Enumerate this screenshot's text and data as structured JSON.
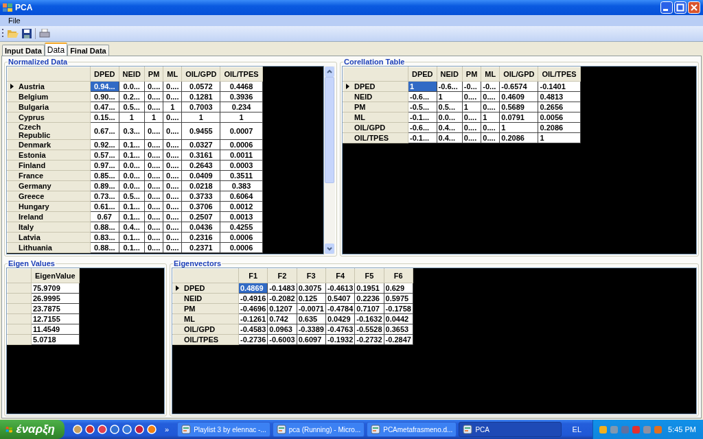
{
  "window": {
    "title": "PCA"
  },
  "menu": [
    "File"
  ],
  "tabs": [
    {
      "label": "Input Data",
      "selected": false
    },
    {
      "label": "Data",
      "selected": true
    },
    {
      "label": "Final Data",
      "selected": false
    }
  ],
  "normalized_data": {
    "title": "Normalized Data",
    "columns": [
      "DPED",
      "NEID",
      "PM",
      "ML",
      "OIL/GPD",
      "OIL/TPES"
    ],
    "rows": [
      {
        "header": "Austria",
        "selected": true,
        "cells": [
          "0.94...",
          "0.0...",
          "0....",
          "0....",
          "0.0572",
          "0.4468"
        ]
      },
      {
        "header": "Belgium",
        "selected": false,
        "cells": [
          "0.90...",
          "0.2...",
          "0....",
          "0....",
          "0.1281",
          "0.3936"
        ]
      },
      {
        "header": "Bulgaria",
        "selected": false,
        "cells": [
          "0.47...",
          "0.5...",
          "0....",
          "1",
          "0.7003",
          "0.234"
        ]
      },
      {
        "header": "Cyprus",
        "selected": false,
        "cells": [
          "0.15...",
          "1",
          "1",
          "0....",
          "1",
          "1"
        ]
      },
      {
        "header": "Czech Republic",
        "selected": false,
        "cells": [
          "0.67...",
          "0.3...",
          "0....",
          "0....",
          "0.9455",
          "0.0007"
        ]
      },
      {
        "header": "Denmark",
        "selected": false,
        "cells": [
          "0.92...",
          "0.1...",
          "0....",
          "0....",
          "0.0327",
          "0.0006"
        ]
      },
      {
        "header": "Estonia",
        "selected": false,
        "cells": [
          "0.57...",
          "0.1...",
          "0....",
          "0....",
          "0.3161",
          "0.0011"
        ]
      },
      {
        "header": "Finland",
        "selected": false,
        "cells": [
          "0.97...",
          "0.0...",
          "0....",
          "0....",
          "0.2643",
          "0.0003"
        ]
      },
      {
        "header": "France",
        "selected": false,
        "cells": [
          "0.85...",
          "0.0...",
          "0....",
          "0....",
          "0.0409",
          "0.3511"
        ]
      },
      {
        "header": "Germany",
        "selected": false,
        "cells": [
          "0.89...",
          "0.0...",
          "0....",
          "0....",
          "0.0218",
          "0.383"
        ]
      },
      {
        "header": "Greece",
        "selected": false,
        "cells": [
          "0.73...",
          "0.5...",
          "0....",
          "0....",
          "0.3733",
          "0.6064"
        ]
      },
      {
        "header": "Hungary",
        "selected": false,
        "cells": [
          "0.61...",
          "0.1...",
          "0....",
          "0....",
          "0.3706",
          "0.0012"
        ]
      },
      {
        "header": "Ireland",
        "selected": false,
        "cells": [
          "0.67",
          "0.1...",
          "0....",
          "0....",
          "0.2507",
          "0.0013"
        ]
      },
      {
        "header": "Italy",
        "selected": false,
        "cells": [
          "0.88...",
          "0.4...",
          "0....",
          "0....",
          "0.0436",
          "0.4255"
        ]
      },
      {
        "header": "Latvia",
        "selected": false,
        "cells": [
          "0.83...",
          "0.1...",
          "0....",
          "0....",
          "0.2316",
          "0.0006"
        ]
      },
      {
        "header": "Lithuania",
        "selected": false,
        "cells": [
          "0.88...",
          "0.1...",
          "0....",
          "0....",
          "0.2371",
          "0.0006"
        ]
      }
    ]
  },
  "correlation_table": {
    "title": "Corellation Table",
    "columns": [
      "DPED",
      "NEID",
      "PM",
      "ML",
      "OIL/GPD",
      "OIL/TPES"
    ],
    "rows": [
      {
        "header": "DPED",
        "selected": true,
        "cells": [
          "1",
          "-0.6...",
          "-0...",
          "-0...",
          "-0.6574",
          "-0.1401"
        ]
      },
      {
        "header": "NEID",
        "selected": false,
        "cells": [
          "-0.6...",
          "1",
          "0....",
          "0....",
          "0.4609",
          "0.4813"
        ]
      },
      {
        "header": "PM",
        "selected": false,
        "cells": [
          "-0.5...",
          "0.5...",
          "1",
          "0....",
          "0.5689",
          "0.2656"
        ]
      },
      {
        "header": "ML",
        "selected": false,
        "cells": [
          "-0.1...",
          "0.0...",
          "0....",
          "1",
          "0.0791",
          "0.0056"
        ]
      },
      {
        "header": "OIL/GPD",
        "selected": false,
        "cells": [
          "-0.6...",
          "0.4...",
          "0....",
          "0....",
          "1",
          "0.2086"
        ]
      },
      {
        "header": "OIL/TPES",
        "selected": false,
        "cells": [
          "-0.1...",
          "0.4...",
          "0....",
          "0....",
          "0.2086",
          "1"
        ]
      }
    ]
  },
  "eigen_values": {
    "title": "Eigen Values",
    "columns": [
      "EigenValue"
    ],
    "rows": [
      {
        "selected": false,
        "cells": [
          "75.9709"
        ]
      },
      {
        "selected": false,
        "cells": [
          "26.9995"
        ]
      },
      {
        "selected": false,
        "cells": [
          "23.7875"
        ]
      },
      {
        "selected": false,
        "cells": [
          "12.7155"
        ]
      },
      {
        "selected": false,
        "cells": [
          "11.4549"
        ]
      },
      {
        "selected": false,
        "cells": [
          "5.0718"
        ]
      }
    ]
  },
  "eigenvectors": {
    "title": "Eigenvectors",
    "columns": [
      "F1",
      "F2",
      "F3",
      "F4",
      "F5",
      "F6"
    ],
    "rows": [
      {
        "header": "DPED",
        "selected": true,
        "cells": [
          "0.4869",
          "-0.1483",
          "0.3075",
          "-0.4613",
          "0.1951",
          "0.629"
        ]
      },
      {
        "header": "NEID",
        "selected": false,
        "cells": [
          "-0.4916",
          "-0.2082",
          "0.125",
          "0.5407",
          "0.2236",
          "0.5975"
        ]
      },
      {
        "header": "PM",
        "selected": false,
        "cells": [
          "-0.4696",
          "0.1207",
          "-0.0071",
          "-0.4784",
          "0.7107",
          "-0.1758"
        ]
      },
      {
        "header": "ML",
        "selected": false,
        "cells": [
          "-0.1261",
          "0.742",
          "0.635",
          "0.0429",
          "-0.1632",
          "0.0442"
        ]
      },
      {
        "header": "OIL/GPD",
        "selected": false,
        "cells": [
          "-0.4583",
          "0.0963",
          "-0.3389",
          "-0.4763",
          "-0.5528",
          "0.3653"
        ]
      },
      {
        "header": "OIL/TPES",
        "selected": false,
        "cells": [
          "-0.2736",
          "-0.6003",
          "0.6097",
          "-0.1932",
          "-0.2732",
          "-0.2847"
        ]
      }
    ]
  },
  "taskbar": {
    "start": "έναρξη",
    "chevron": "»",
    "tasks": [
      {
        "label": "Playlist 3 by elennac -...",
        "selected": false
      },
      {
        "label": "pca (Running) - Micro...",
        "selected": false
      },
      {
        "label": "PCAmetafrasmeno.d...",
        "selected": false
      },
      {
        "label": "PCA",
        "selected": true
      }
    ],
    "language": "EL",
    "clock": "5:45 PM"
  }
}
